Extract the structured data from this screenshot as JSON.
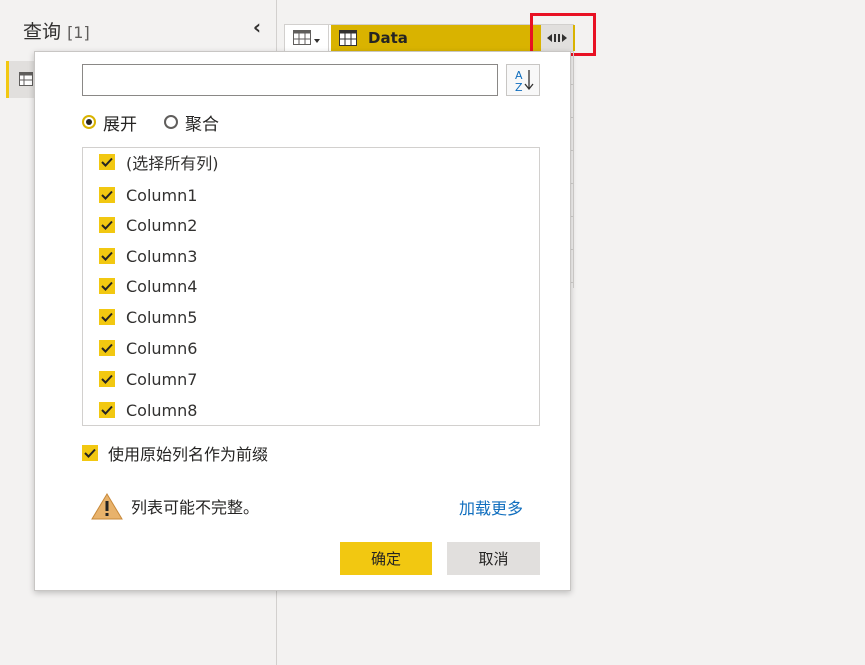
{
  "query_pane": {
    "title": "查询",
    "count": "[1]"
  },
  "grid": {
    "column_name": "Data"
  },
  "popup": {
    "search": {
      "value": "",
      "placeholder": ""
    },
    "mode_options": [
      {
        "label": "展开",
        "selected": true
      },
      {
        "label": "聚合",
        "selected": false
      }
    ],
    "columns": [
      {
        "label": "(选择所有列)",
        "checked": true
      },
      {
        "label": "Column1",
        "checked": true
      },
      {
        "label": "Column2",
        "checked": true
      },
      {
        "label": "Column3",
        "checked": true
      },
      {
        "label": "Column4",
        "checked": true
      },
      {
        "label": "Column5",
        "checked": true
      },
      {
        "label": "Column6",
        "checked": true
      },
      {
        "label": "Column7",
        "checked": true
      },
      {
        "label": "Column8",
        "checked": true
      }
    ],
    "prefix_option": {
      "label": "使用原始列名作为前缀",
      "checked": true
    },
    "warning": "列表可能不完整。",
    "load_more": "加载更多",
    "ok_label": "确定",
    "cancel_label": "取消"
  },
  "colors": {
    "accent": "#f2c811",
    "header_fill": "#d9b300",
    "highlight": "#e81123",
    "link": "#106ebe"
  },
  "icons": {
    "table": "table-icon",
    "collapse": "chevron-left-icon",
    "expand": "expand-columns-icon",
    "sort": "sort-az-icon",
    "warning": "warning-icon"
  }
}
